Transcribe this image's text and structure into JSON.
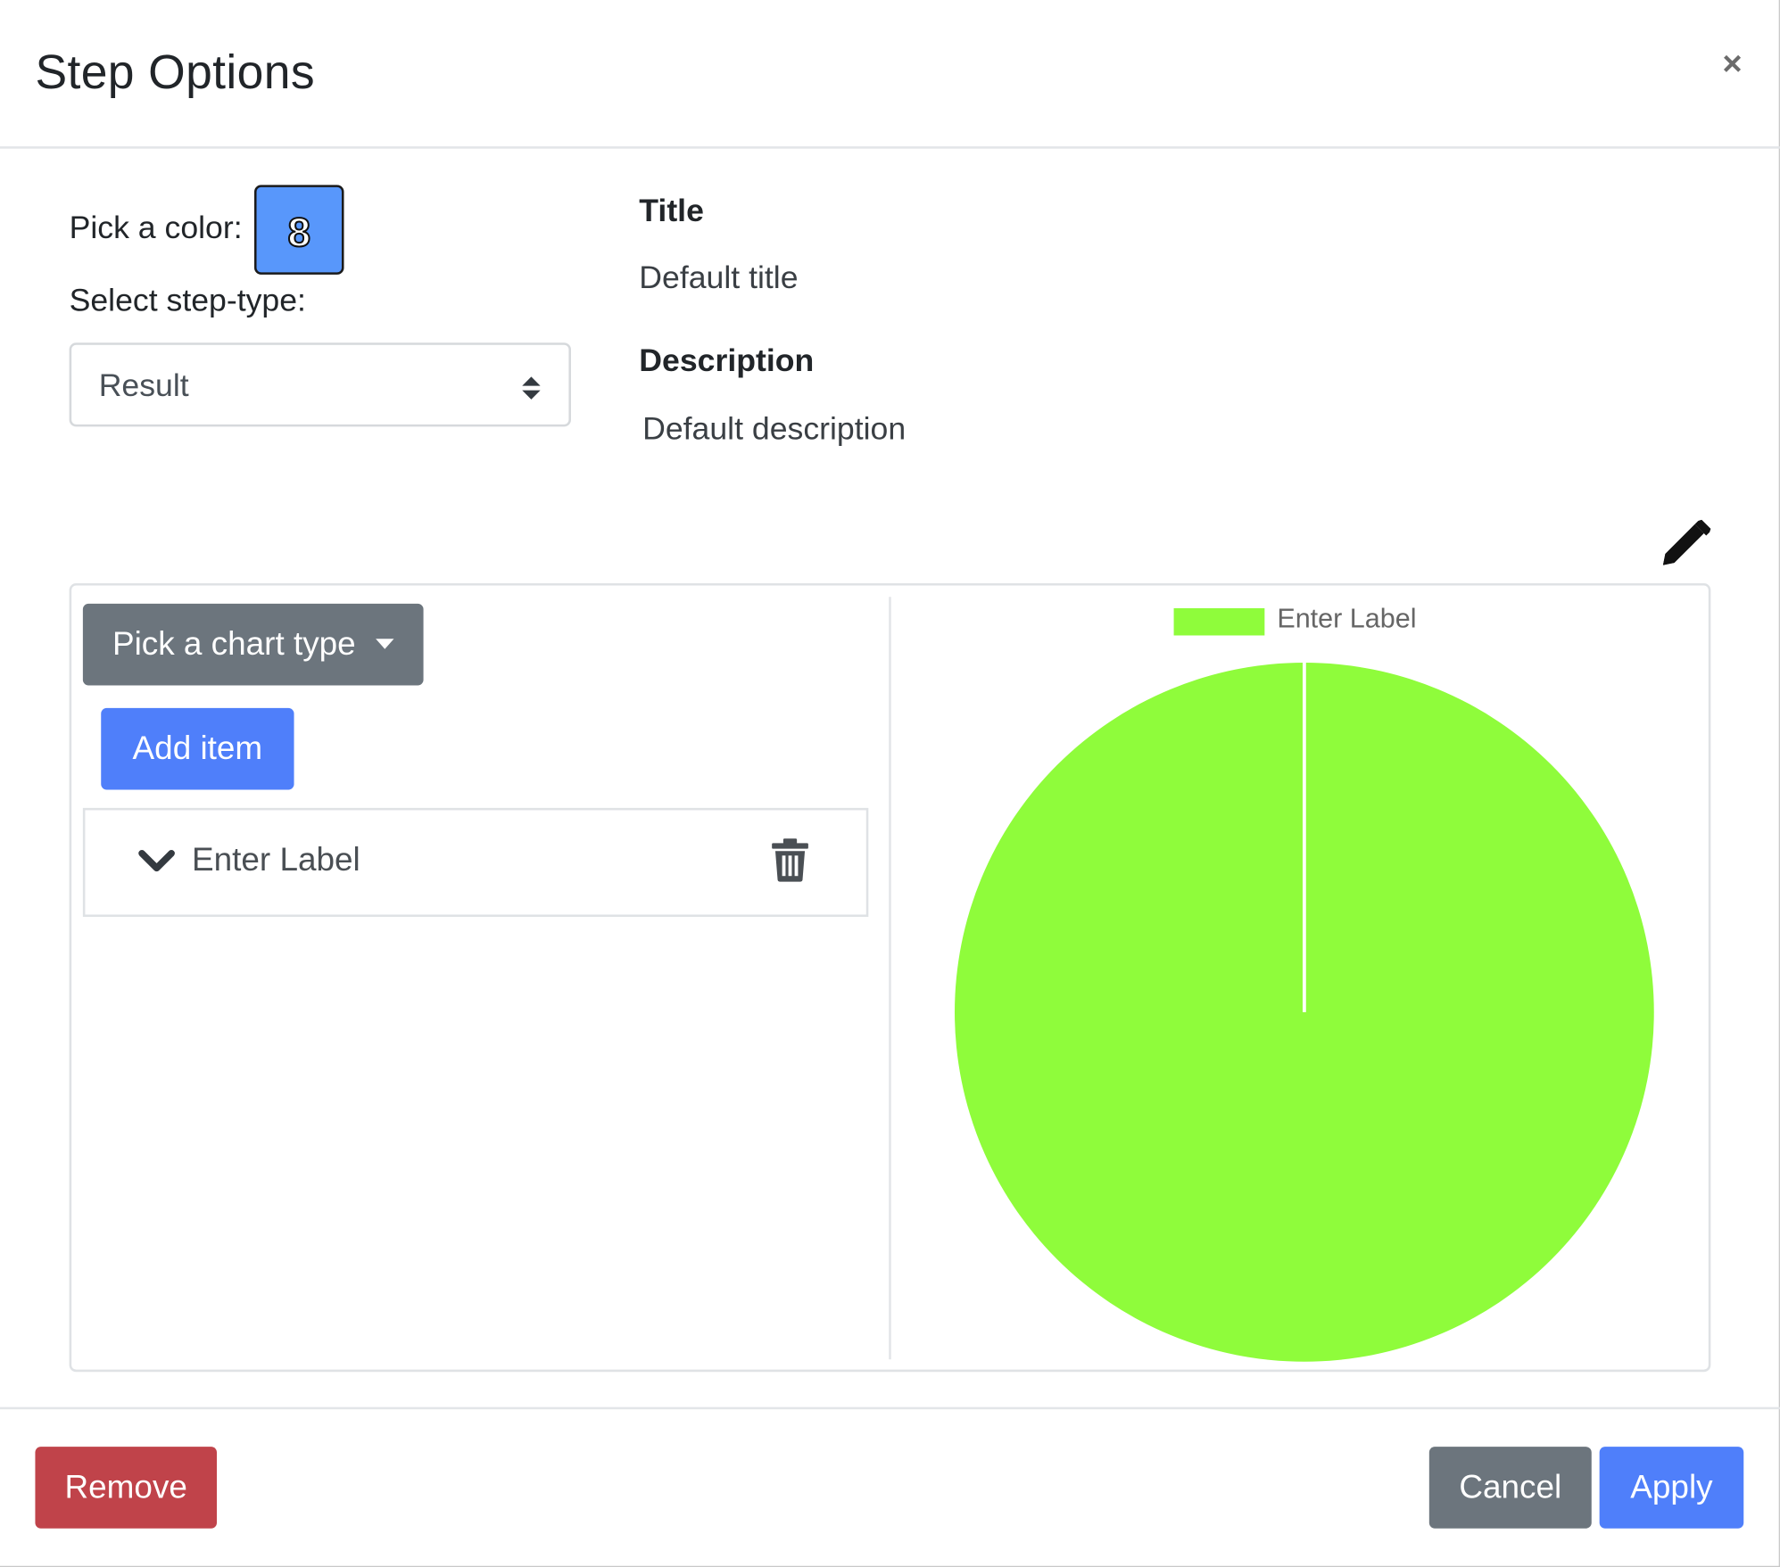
{
  "modal": {
    "title": "Step Options",
    "close_label": "×"
  },
  "color_picker": {
    "label": "Pick a color:",
    "value_text": "8",
    "color": "#5897fb"
  },
  "step_type": {
    "label": "Select step-type:",
    "selected": "Result"
  },
  "title_field": {
    "heading": "Title",
    "value": "Default title"
  },
  "description_field": {
    "heading": "Description",
    "value": "Default description"
  },
  "edit": {
    "icon": "pencil-icon"
  },
  "editor": {
    "chart_type_button": "Pick a chart type",
    "add_item_button": "Add item",
    "items": [
      {
        "label": "Enter Label",
        "expand_icon": "chevron-down-icon",
        "delete_icon": "trash-icon"
      }
    ]
  },
  "chart_data": {
    "type": "pie",
    "categories": [
      "Enter Label"
    ],
    "values": [
      100
    ],
    "colors": [
      "#8ffc3b"
    ],
    "legend": "top"
  },
  "footer": {
    "remove_button": "Remove",
    "cancel_button": "Cancel",
    "apply_button": "Apply"
  },
  "colors": {
    "primary": "#4f7ffa",
    "secondary": "#6c757d",
    "danger": "#c0434a"
  }
}
